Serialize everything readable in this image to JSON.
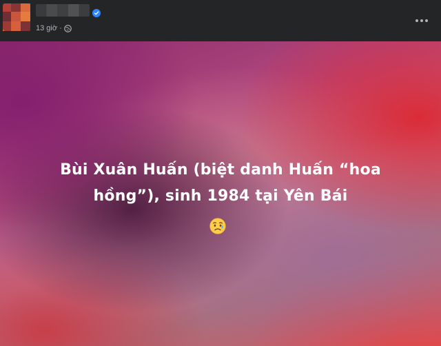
{
  "post": {
    "author_name": "",
    "timestamp": "13 giờ",
    "separator": "·",
    "privacy_icon": "globe-icon",
    "verified_icon": "verified-badge-icon",
    "menu_icon": "more-horizontal-icon",
    "text": "Bùi Xuân Huấn (biệt danh Huấn “hoa hồng”), sinh 1984 tại Yên Bái",
    "emoji": "😥",
    "emoji_name": "sad-but-relieved-face-icon"
  },
  "colors": {
    "header_bg": "#242526",
    "meta_text": "#b0b3b8",
    "verified_blue": "#2d88ff",
    "post_text": "#ffffff"
  }
}
